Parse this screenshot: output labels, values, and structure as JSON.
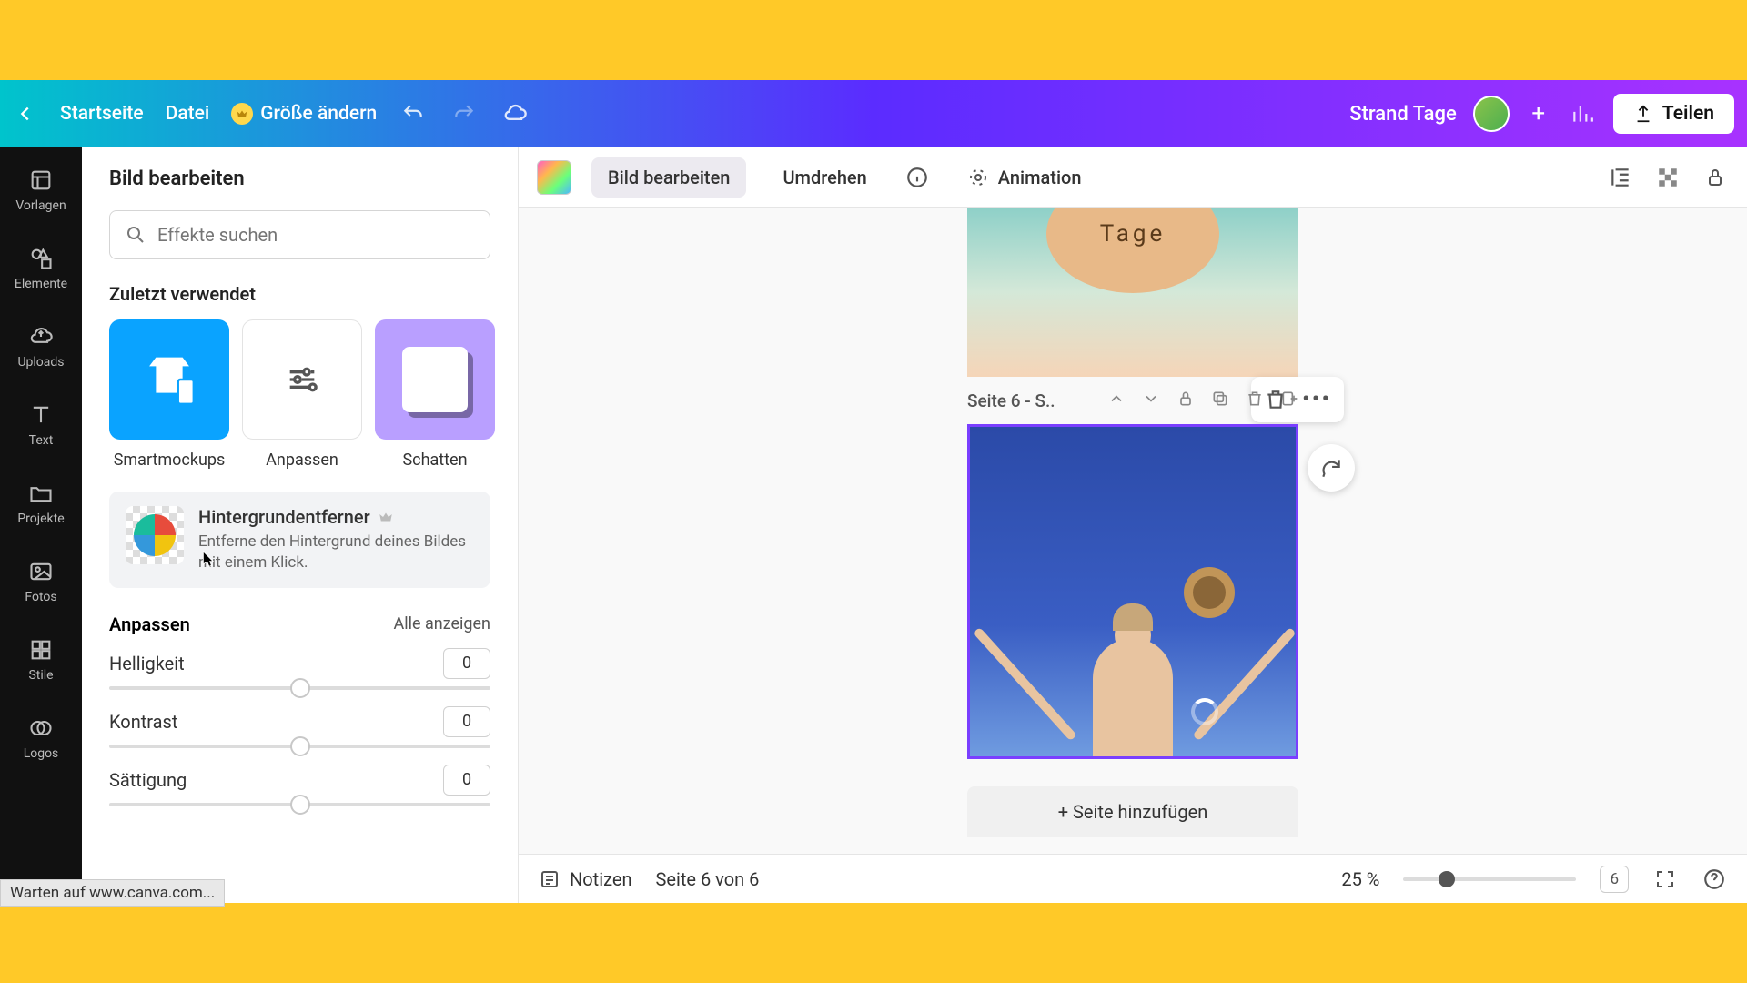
{
  "toolbar": {
    "home": "Startseite",
    "file": "Datei",
    "resize": "Größe ändern",
    "doc_title": "Strand Tage",
    "share": "Teilen"
  },
  "nav": {
    "templates": "Vorlagen",
    "elements": "Elemente",
    "uploads": "Uploads",
    "text": "Text",
    "projects": "Projekte",
    "photos": "Fotos",
    "styles": "Stile",
    "logos": "Logos"
  },
  "panel": {
    "title": "Bild bearbeiten",
    "search_placeholder": "Effekte suchen",
    "recent_label": "Zuletzt verwendet",
    "effects": {
      "smartmockups": "Smartmockups",
      "adjust": "Anpassen",
      "shadow": "Schatten"
    },
    "bg_remover": {
      "title": "Hintergrundentferner",
      "desc": "Entferne den Hintergrund deines Bildes mit einem Klick."
    },
    "adjust_section": {
      "title": "Anpassen",
      "show_all": "Alle anzeigen",
      "brightness": {
        "label": "Helligkeit",
        "value": "0"
      },
      "contrast": {
        "label": "Kontrast",
        "value": "0"
      },
      "saturation": {
        "label": "Sättigung",
        "value": "0"
      }
    }
  },
  "edit_toolbar": {
    "edit_image": "Bild bearbeiten",
    "flip": "Umdrehen",
    "animation": "Animation"
  },
  "canvas": {
    "page_badge_text": "Tage",
    "page_label": "Seite 6 - S..",
    "add_page": "+ Seite hinzufügen"
  },
  "bottom": {
    "notes": "Notizen",
    "page_info": "Seite 6 von 6",
    "zoom": "25 %",
    "page_num": "6"
  },
  "status": "Warten auf www.canva.com..."
}
